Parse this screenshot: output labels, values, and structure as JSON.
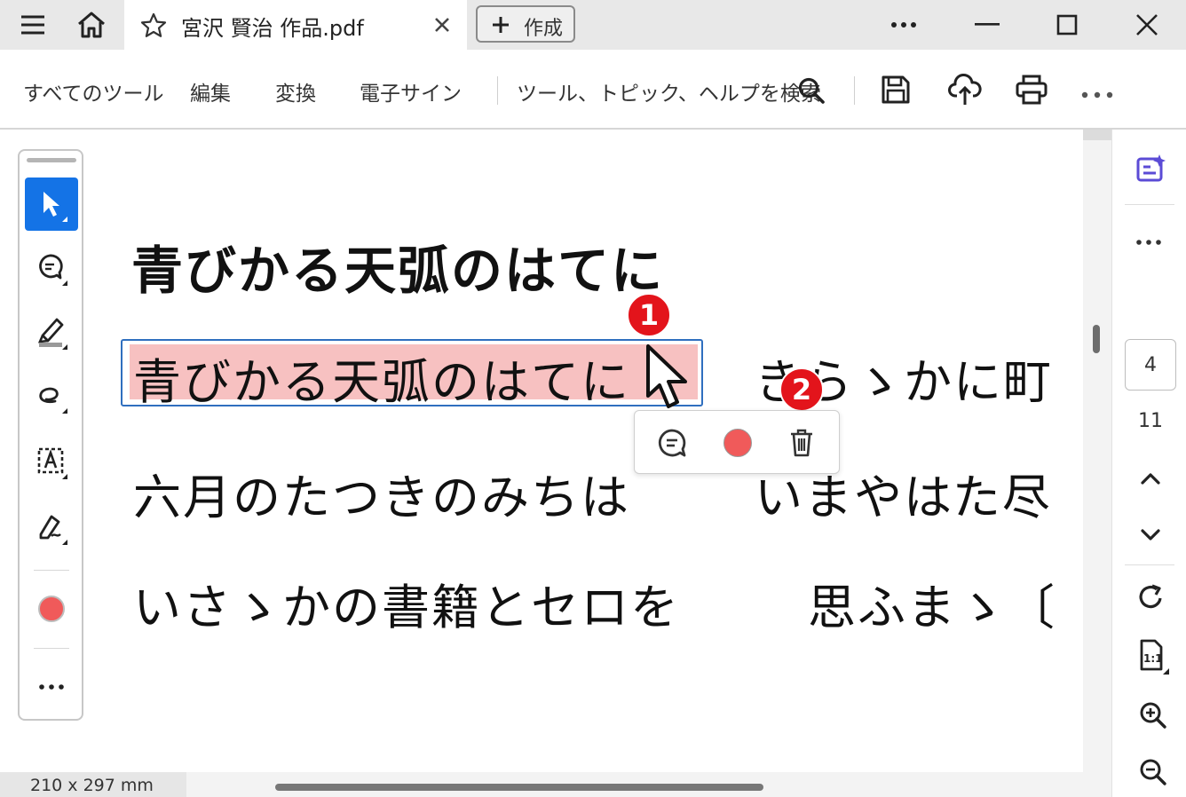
{
  "titlebar": {
    "tab_title": "宮沢 賢治 作品.pdf",
    "create_label": "作成"
  },
  "toolbar": {
    "all_tools": "すべてのツール",
    "edit": "編集",
    "convert": "変換",
    "e_sign": "電子サイン",
    "search_placeholder": "ツール、トピック、ヘルプを検索"
  },
  "document": {
    "heading": "青びかる天弧のはてに",
    "lines": [
      {
        "left": "青びかる天弧のはてに",
        "right": "きらゝかに町"
      },
      {
        "left": "六月のたつきのみちは",
        "right": "いまやはた尽"
      },
      {
        "left": "いさゝかの書籍とセロを",
        "right": "思ふまゝ〔"
      }
    ]
  },
  "badges": [
    "1",
    "2"
  ],
  "page_nav": {
    "current_page": "4",
    "total_pages": "11"
  },
  "status": {
    "page_size": "210 x 297 mm"
  },
  "colors": {
    "accent": "#1473e6",
    "highlight": "#f7c1c1",
    "annotation_red": "#f05a5a",
    "badge_red": "#e3141b",
    "ai_purple": "#5b4bd6"
  }
}
